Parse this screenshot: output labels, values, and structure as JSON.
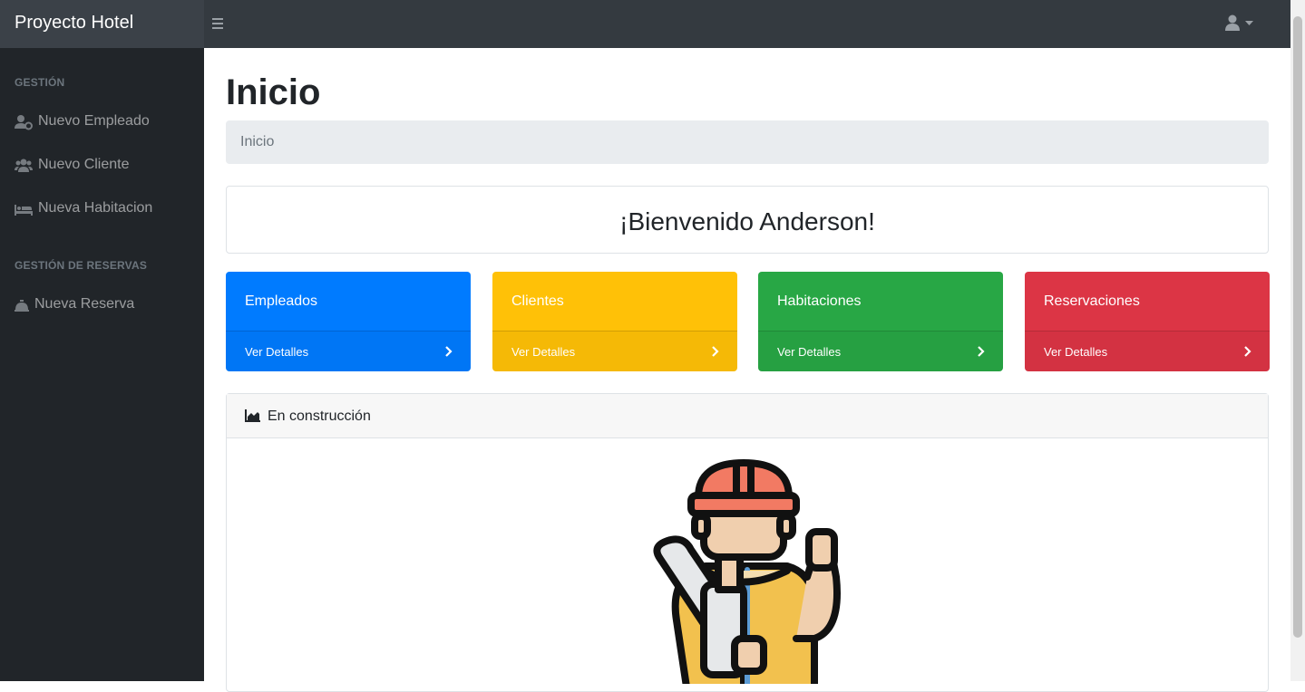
{
  "app": {
    "brand": "Proyecto Hotel"
  },
  "topbar": {
    "menu_icon": "bars-icon",
    "user_icon": "user-icon"
  },
  "sidebar": {
    "sections": [
      {
        "heading": "GESTIÓN",
        "items": [
          {
            "label": "Nuevo Empleado",
            "icon": "user-cog-icon"
          },
          {
            "label": "Nuevo Cliente",
            "icon": "users-icon"
          },
          {
            "label": "Nueva Habitacion",
            "icon": "bed-icon"
          }
        ]
      },
      {
        "heading": "GESTIÓN DE RESERVAS",
        "items": [
          {
            "label": "Nueva Reserva",
            "icon": "concierge-bell-icon"
          }
        ]
      }
    ]
  },
  "main": {
    "title": "Inicio",
    "breadcrumb": "Inicio",
    "welcome": "¡Bienvenido Anderson!",
    "cards": [
      {
        "title": "Empleados",
        "link": "Ver Detalles",
        "color": "#007bff"
      },
      {
        "title": "Clientes",
        "link": "Ver Detalles",
        "color": "#ffc107"
      },
      {
        "title": "Habitaciones",
        "link": "Ver Detalles",
        "color": "#28a745"
      },
      {
        "title": "Reservaciones",
        "link": "Ver Detalles",
        "color": "#dc3545"
      }
    ],
    "panel": {
      "title": "En construcción",
      "icon": "area-chart-icon",
      "image": "construction-worker-illustration"
    }
  }
}
